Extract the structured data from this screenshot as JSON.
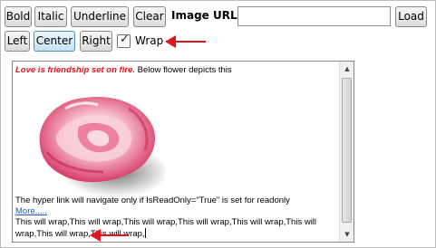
{
  "toolbar": {
    "bold": "Bold",
    "italic": "Italic",
    "underline": "Underline",
    "clear": "Clear",
    "image_url_label": "Image URL",
    "image_url_value": "",
    "load": "Load",
    "left": "Left",
    "center": "Center",
    "right": "Right",
    "wrap_label": "Wrap",
    "wrap_checked": true
  },
  "editor": {
    "quote": "Love is friendship set on fire.",
    "intro": "  Below flower depicts this",
    "image_icon": "rose-image",
    "readonly_note": "The hyper link will navigate only if IsReadOnly=\"True\" is set for readonly",
    "link_text": "More.....",
    "wrap_text": "This will wrap,This will wrap,This will wrap,This will wrap,This will wrap,This will wrap,This will wrap,This will wrap,"
  },
  "colors": {
    "quote": "#e1141e",
    "link": "#1a5cc8",
    "arrow": "#e0141e",
    "active_button": "#c6e3f5"
  },
  "icons": {
    "checkbox": "check-icon",
    "annotation": "red-arrow-icon",
    "scroll_up": "up-arrow-icon",
    "scroll_down": "down-arrow-icon"
  }
}
